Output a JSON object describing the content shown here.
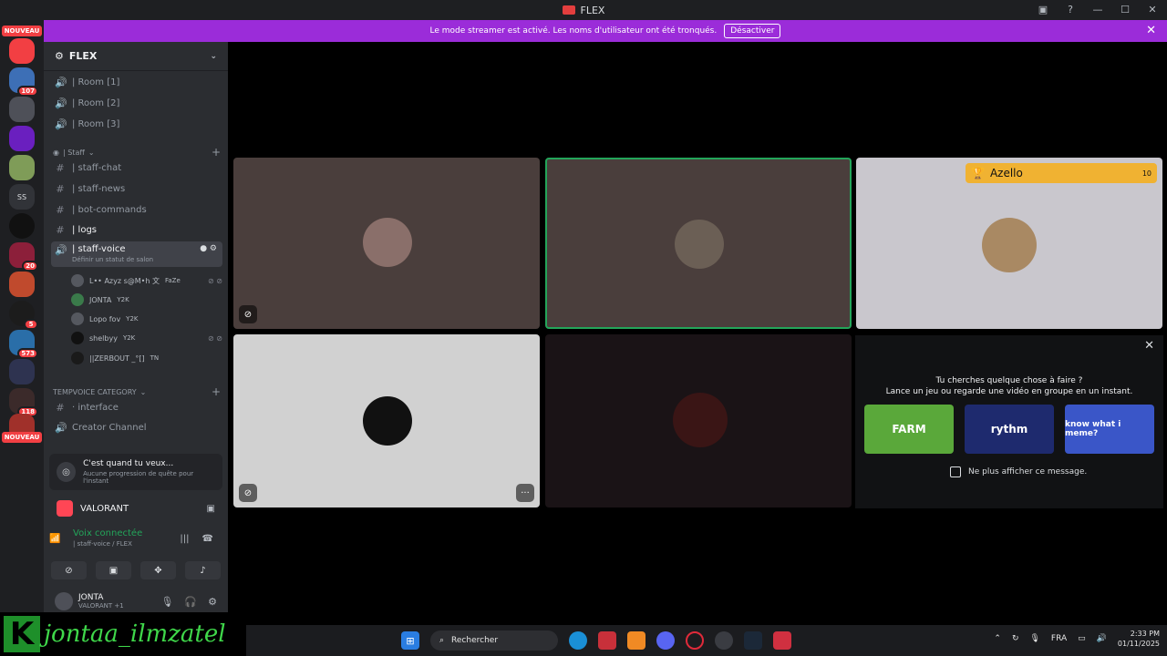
{
  "window": {
    "title": "FLEX"
  },
  "banner": {
    "text": "Le mode streamer est activé. Les noms d'utilisateur ont été tronqués.",
    "button": "Désactiver"
  },
  "rail": {
    "nouveau_top": "NOUVEAU",
    "nouveau_bottom": "NOUVEAU",
    "ss_label": "SS",
    "badges": [
      "107",
      "20",
      "5",
      "573",
      "118"
    ]
  },
  "guild": {
    "name": "FLEX"
  },
  "channels": {
    "room1": "| Room [1]",
    "room2": "| Room [2]",
    "room3": "| Room [3]",
    "staff_category": "| Staff",
    "staff_chat": "| staff-chat",
    "staff_news": "| staff-news",
    "bot_commands": "| bot-commands",
    "logs": "| logs",
    "staff_voice": "| staff-voice",
    "staff_voice_status": "Définir un statut de salon",
    "temp_category": "TEMPVOICE CATEGORY",
    "interface": "· interface",
    "creator": "Creator Channel"
  },
  "members": [
    {
      "name": "L•• Azyz s@M•h 文",
      "tag": "FaZe"
    },
    {
      "name": "JONTA",
      "tag": "Y2K"
    },
    {
      "name": "Lopo fov",
      "tag": "Y2K"
    },
    {
      "name": "shelbyy",
      "tag": "Y2K"
    },
    {
      "name": "||ZERBOUT _°[]",
      "tag": "TN"
    }
  ],
  "quest": {
    "title": "C'est quand tu veux...",
    "subtitle": "Aucune progression de quête pour l'instant"
  },
  "activity": {
    "name": "VALORANT"
  },
  "voice": {
    "status": "Voix connectée",
    "channel": "| staff-voice / FLEX"
  },
  "user": {
    "name": "JONTA",
    "status": "VALORANT +1"
  },
  "watermark": {
    "letter": "K",
    "name": "jontaa_ilmzatel"
  },
  "tiles": {
    "azello_name": "Azello",
    "azello_count": "10"
  },
  "promo": {
    "line1": "Tu cherches quelque chose à faire ?",
    "line2": "Lance un jeu ou regarde une vidéo en groupe en un instant.",
    "games": [
      "FARM",
      "rythm",
      "know what i meme?"
    ],
    "checkbox": "Ne plus afficher ce message."
  },
  "taskbar": {
    "search": "Rechercher",
    "lang": "FRA",
    "time": "2:33 PM",
    "date": "01/11/2025"
  },
  "colors": {
    "accent": "#9b2cd9",
    "voice_green": "#23a55a",
    "tile_highlight": "#23a55a",
    "badge_red": "#f23f43",
    "azello": "#f0b232"
  }
}
